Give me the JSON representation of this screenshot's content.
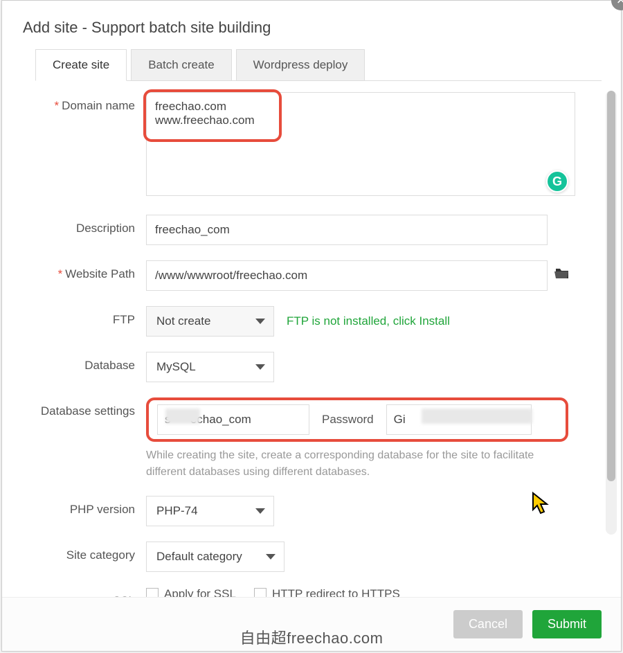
{
  "header": {
    "title": "Add site - Support batch site building"
  },
  "tabs": [
    {
      "label": "Create site",
      "active": true
    },
    {
      "label": "Batch create",
      "active": false
    },
    {
      "label": "Wordpress deploy",
      "active": false
    }
  ],
  "form": {
    "domain": {
      "label": "Domain name",
      "required": true,
      "value": "freechao.com\nwww.freechao.com"
    },
    "description": {
      "label": "Description",
      "value": "freechao_com"
    },
    "path": {
      "label": "Website Path",
      "required": true,
      "value": "/www/wwwroot/freechao.com"
    },
    "ftp": {
      "label": "FTP",
      "selected": "Not create",
      "hint": "FTP is not installed, click Install"
    },
    "database": {
      "label": "Database",
      "selected": "MySQL"
    },
    "db_settings": {
      "label": "Database settings",
      "user_value": "s      echao_com",
      "password_label": "Password",
      "password_value": "Gi",
      "help": "While creating the site, create a corresponding database for the site to facilitate different databases using different databases."
    },
    "php": {
      "label": "PHP version",
      "selected": "PHP-74"
    },
    "category": {
      "label": "Site category",
      "selected": "Default category"
    },
    "ssl": {
      "label": "SSL",
      "apply_label": "Apply for SSL",
      "redirect_label": "HTTP redirect to HTTPS"
    }
  },
  "footer": {
    "cancel": "Cancel",
    "submit": "Submit"
  },
  "watermark": "自由超freechao.com"
}
